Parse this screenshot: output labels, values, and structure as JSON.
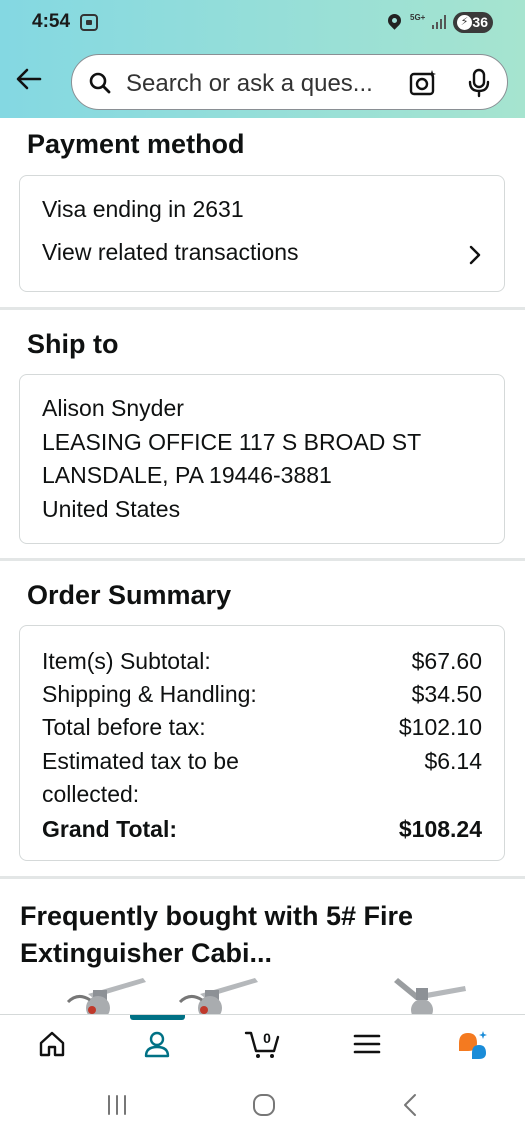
{
  "status_bar": {
    "time": "4:54",
    "network": "5G+",
    "battery": "36"
  },
  "search": {
    "placeholder": "Search or ask a ques..."
  },
  "payment": {
    "title": "Payment method",
    "card": "Visa ending in 2631",
    "link": "View related transactions"
  },
  "ship": {
    "title": "Ship to",
    "lines": [
      "Alison Snyder",
      "LEASING OFFICE 117 S BROAD ST",
      "LANSDALE, PA 19446-3881",
      "United States"
    ]
  },
  "summary": {
    "title": "Order Summary",
    "rows": [
      {
        "label": "Item(s) Subtotal:",
        "value": "$67.60"
      },
      {
        "label": "Shipping & Handling:",
        "value": "$34.50"
      },
      {
        "label": "Total before tax:",
        "value": "$102.10"
      },
      {
        "label": "Estimated tax to be",
        "label2": "collected:",
        "value": "$6.14"
      },
      {
        "label": "Grand Total:",
        "value": "$108.24"
      }
    ]
  },
  "fbt": {
    "title": "Frequently bought with 5# Fire Extinguisher Cabi..."
  },
  "bottom_nav": {
    "items": [
      "home-icon",
      "account-icon",
      "cart-icon",
      "menu-icon",
      "rufus-icon"
    ],
    "cart_count": "0",
    "active": "account"
  },
  "colors": {
    "accent": "#007185",
    "header_start": "#84d8e2",
    "header_end": "#a6e4cf"
  }
}
